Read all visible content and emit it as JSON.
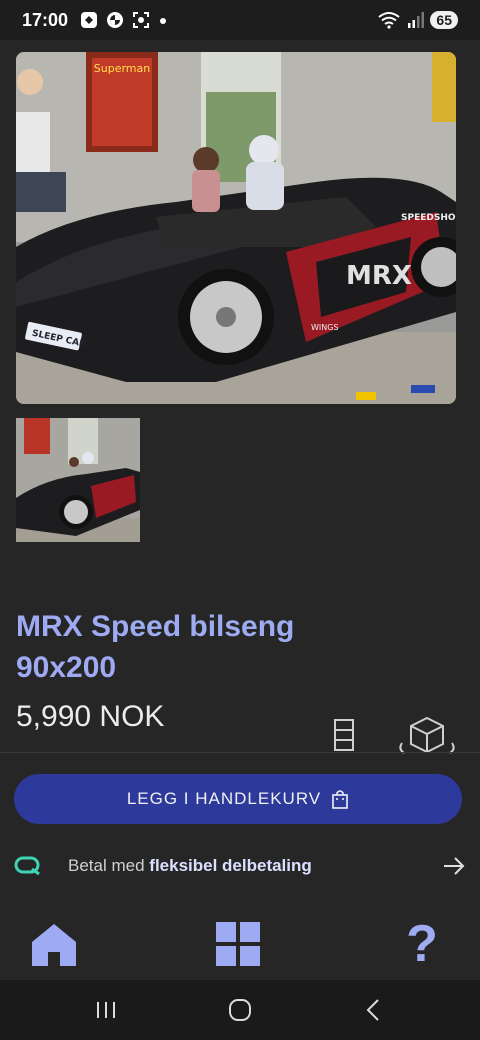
{
  "status_bar": {
    "time": "17:00",
    "status_icons": [
      "bereal-icon",
      "bmw-icon",
      "screenshot-icon",
      "dot-icon"
    ],
    "right_icons": [
      "wifi-icon",
      "signal-icon"
    ],
    "battery": "65"
  },
  "gallery": {
    "main_image": {
      "alt": "MRX car bed photo",
      "print_text": {
        "car_logo": "MRX",
        "sponsor": "SPEEDSHOP",
        "plate": "SLEEP CAR",
        "wings": "WINGS",
        "poster": "Superman"
      }
    },
    "thumbnail": {
      "alt": "MRX car bed thumbnail"
    }
  },
  "product": {
    "title": "MRX Speed bilseng 90x200",
    "price": "5,990 NOK"
  },
  "actions": {
    "add_to_cart": "LEGG I HANDLEKURV",
    "installment_prefix": "Betal med",
    "installment_bold": "fleksibel delbetaling"
  },
  "tabs": [
    {
      "name": "home",
      "icon": "home-icon"
    },
    {
      "name": "categories",
      "icon": "grid-icon"
    },
    {
      "name": "help",
      "icon": "question-icon",
      "glyph": "?"
    }
  ],
  "colors": {
    "accent": "#9eaaf2",
    "button": "#2d3a9c",
    "background": "#262626",
    "installment_brand": "#3ed4b5"
  }
}
